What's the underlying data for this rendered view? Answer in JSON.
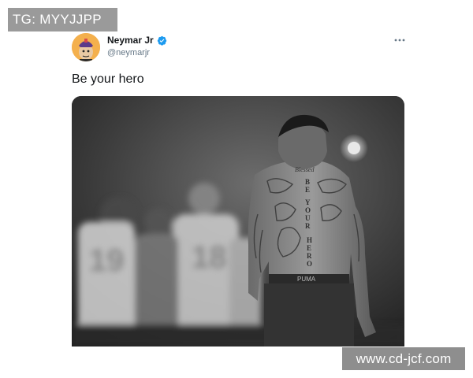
{
  "watermarks": {
    "top_left": "TG: MYYJJPP",
    "bottom_right": "www.cd-jcf.com"
  },
  "tweet": {
    "author_name": "Neymar Jr",
    "author_handle": "@neymarjr",
    "verified": true,
    "text": "Be your hero",
    "more_icon": "more-horizontal-icon",
    "photo": {
      "shirt_numbers": [
        "19",
        "18"
      ],
      "tattoo_words": [
        "Blessed",
        "BE",
        "YOUR",
        "HERO"
      ],
      "waistband_text": "PUMA"
    }
  },
  "colors": {
    "verified_blue": "#1d9bf0",
    "text_primary": "#14171a",
    "text_secondary": "#657786",
    "watermark_gray": "#9a9a9a"
  }
}
